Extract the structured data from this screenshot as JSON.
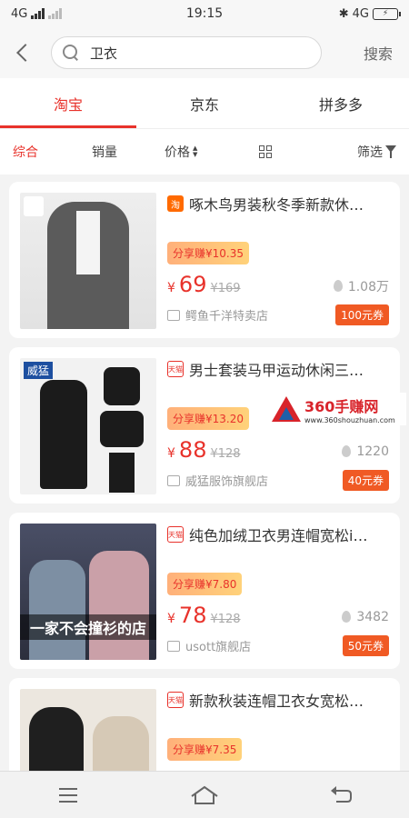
{
  "status_bar": {
    "network_left": "4G",
    "time": "19:15",
    "network_right": "4G",
    "battery": "⚡"
  },
  "search": {
    "value": "卫衣",
    "button_label": "搜索"
  },
  "platform_tabs": [
    {
      "label": "淘宝",
      "active": true
    },
    {
      "label": "京东",
      "active": false
    },
    {
      "label": "拼多多",
      "active": false
    }
  ],
  "sort_bar": {
    "comprehensive": "综合",
    "sales": "销量",
    "price": "价格",
    "filter": "筛选"
  },
  "products": [
    {
      "platform": "淘",
      "title": "啄木鸟男装秋冬季新款休…",
      "share": "分享赚¥10.35",
      "yen": "¥",
      "price": "69",
      "original": "¥169",
      "sales": "1.08万",
      "shop": "鳄鱼千洋特卖店",
      "coupon": "100元券",
      "thumb_colors": [
        "#e8e8e8",
        "#5a5a5a"
      ]
    },
    {
      "platform": "天猫",
      "title": "男士套装马甲运动休闲三…",
      "share": "分享赚¥13.20",
      "yen": "¥",
      "price": "88",
      "original": "¥128",
      "sales": "1220",
      "shop": "威猛服饰旗舰店",
      "coupon": "40元券",
      "thumb_tag": "威猛",
      "thumb_colors": [
        "#f0f0f0",
        "#1a1a1a"
      ]
    },
    {
      "platform": "天猫",
      "title": "纯色加绒卫衣男连帽宽松i…",
      "share": "分享赚¥7.80",
      "yen": "¥",
      "price": "78",
      "original": "¥128",
      "sales": "3482",
      "shop": "usott旗舰店",
      "coupon": "50元券",
      "thumb_caption": "一家不会撞衫的店",
      "thumb_colors": [
        "#3a3f55",
        "#c98f9a"
      ]
    },
    {
      "platform": "天猫",
      "title": "新款秋装连帽卫衣女宽松…",
      "share": "分享赚¥7.35",
      "thumb_colors": [
        "#d8d2c8",
        "#1f1f1f"
      ]
    }
  ],
  "watermark": {
    "title": "360手赚网",
    "url": "www.360shouzhuan.com"
  },
  "colors": {
    "accent": "#e8322b",
    "coupon": "#f05a24"
  }
}
